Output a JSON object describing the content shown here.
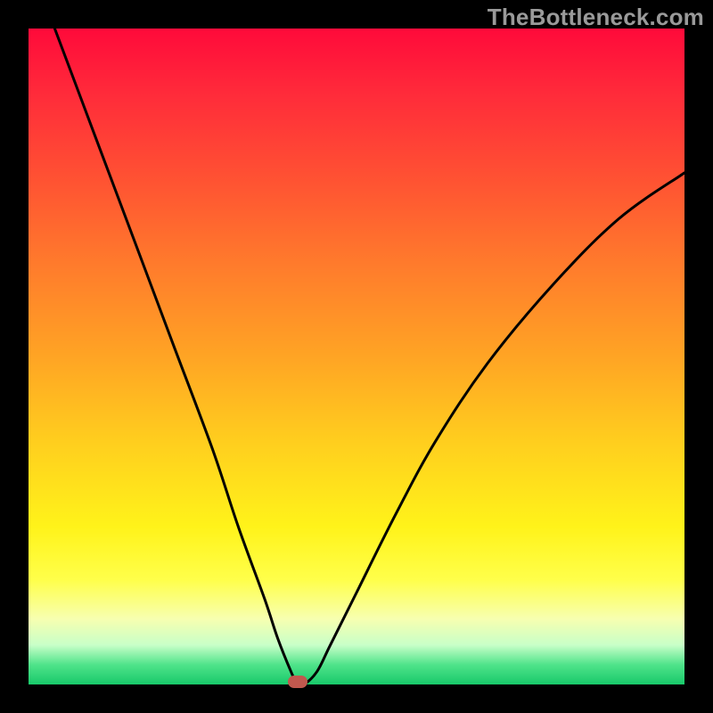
{
  "watermark": "TheBottleneck.com",
  "chart_data": {
    "type": "line",
    "title": "",
    "xlabel": "",
    "ylabel": "",
    "xlim": [
      0,
      100
    ],
    "ylim": [
      0,
      100
    ],
    "legend": false,
    "grid": false,
    "series": [
      {
        "name": "bottleneck-curve",
        "x": [
          4,
          10,
          16,
          22,
          28,
          32,
          36,
          38,
          40,
          41,
          42,
          44,
          46,
          50,
          56,
          62,
          70,
          80,
          90,
          100
        ],
        "values": [
          100,
          84,
          68,
          52,
          36,
          24,
          13,
          7,
          2,
          0,
          0,
          2,
          6,
          14,
          26,
          37,
          49,
          61,
          71,
          78
        ]
      }
    ],
    "annotations": [
      {
        "name": "optimum-marker",
        "x": 41,
        "y": 0
      }
    ],
    "background_gradient": {
      "top_color": "#ff0a3a",
      "mid_color": "#ffff4a",
      "bottom_color": "#18c96a",
      "meaning": "red=high bottleneck, green=low bottleneck"
    }
  }
}
